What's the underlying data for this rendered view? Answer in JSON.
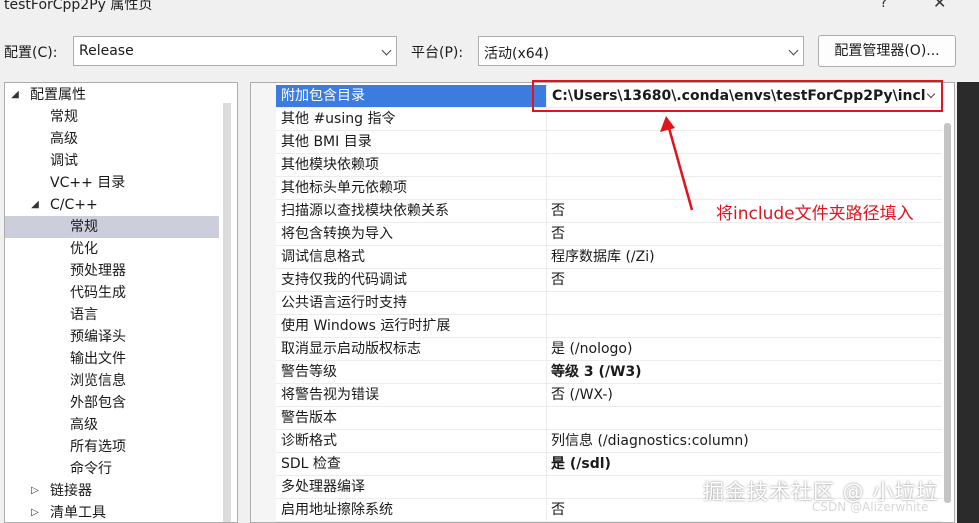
{
  "window": {
    "title": "testForCpp2Py 属性页",
    "help_glyph": "?",
    "close_glyph": "✕"
  },
  "config_bar": {
    "config_label": "配置(C):",
    "config_value": "Release",
    "platform_label": "平台(P):",
    "platform_value": "活动(x64)",
    "manager_button": "配置管理器(O)..."
  },
  "tree": {
    "items": [
      {
        "label": "配置属性",
        "toggle": "◢",
        "level": 0
      },
      {
        "label": "常规",
        "toggle": "",
        "level": 1
      },
      {
        "label": "高级",
        "toggle": "",
        "level": 1
      },
      {
        "label": "调试",
        "toggle": "",
        "level": 1
      },
      {
        "label": "VC++ 目录",
        "toggle": "",
        "level": 1
      },
      {
        "label": "C/C++",
        "toggle": "◢",
        "level": 1
      },
      {
        "label": "常规",
        "toggle": "",
        "level": 2,
        "selected": true
      },
      {
        "label": "优化",
        "toggle": "",
        "level": 2
      },
      {
        "label": "预处理器",
        "toggle": "",
        "level": 2
      },
      {
        "label": "代码生成",
        "toggle": "",
        "level": 2
      },
      {
        "label": "语言",
        "toggle": "",
        "level": 2
      },
      {
        "label": "预编译头",
        "toggle": "",
        "level": 2
      },
      {
        "label": "输出文件",
        "toggle": "",
        "level": 2
      },
      {
        "label": "浏览信息",
        "toggle": "",
        "level": 2
      },
      {
        "label": "外部包含",
        "toggle": "",
        "level": 2
      },
      {
        "label": "高级",
        "toggle": "",
        "level": 2
      },
      {
        "label": "所有选项",
        "toggle": "",
        "level": 2
      },
      {
        "label": "命令行",
        "toggle": "",
        "level": 2
      },
      {
        "label": "链接器",
        "toggle": "▷",
        "level": 1
      },
      {
        "label": "清单工具",
        "toggle": "▷",
        "level": 1
      }
    ]
  },
  "properties": [
    {
      "name": "附加包含目录",
      "value": "C:\\Users\\13680\\.conda\\envs\\testForCpp2Py\\incl",
      "selected": true,
      "bold": true,
      "editing": true
    },
    {
      "name": "其他 #using 指令",
      "value": ""
    },
    {
      "name": "其他 BMI 目录",
      "value": ""
    },
    {
      "name": "其他模块依赖项",
      "value": ""
    },
    {
      "name": "其他标头单元依赖项",
      "value": ""
    },
    {
      "name": "扫描源以查找模块依赖关系",
      "value": "否"
    },
    {
      "name": "将包含转换为导入",
      "value": "否"
    },
    {
      "name": "调试信息格式",
      "value": "程序数据库 (/Zi)"
    },
    {
      "name": "支持仅我的代码调试",
      "value": "否"
    },
    {
      "name": "公共语言运行时支持",
      "value": ""
    },
    {
      "name": "使用 Windows 运行时扩展",
      "value": ""
    },
    {
      "name": "取消显示启动版权标志",
      "value": "是 (/nologo)"
    },
    {
      "name": "警告等级",
      "value": "等级 3 (/W3)",
      "bold": true
    },
    {
      "name": "将警告视为错误",
      "value": "否 (/WX-)"
    },
    {
      "name": "警告版本",
      "value": ""
    },
    {
      "name": "诊断格式",
      "value": "列信息 (/diagnostics:column)"
    },
    {
      "name": "SDL 检查",
      "value": "是 (/sdl)",
      "bold": true
    },
    {
      "name": "多处理器编译",
      "value": ""
    },
    {
      "name": "启用地址擦除系统",
      "value": "否"
    }
  ],
  "annotation": {
    "text": "将include文件夹路径填入",
    "color": "#e0141e"
  },
  "watermark": {
    "main": "掘金技术社区 @ 小垃垃",
    "sub": "CSDN @Alizerwhite"
  },
  "colors": {
    "selection_blue": "#3b7cde",
    "tree_selection": "#cccedb",
    "annotation_red": "#e0141e"
  }
}
